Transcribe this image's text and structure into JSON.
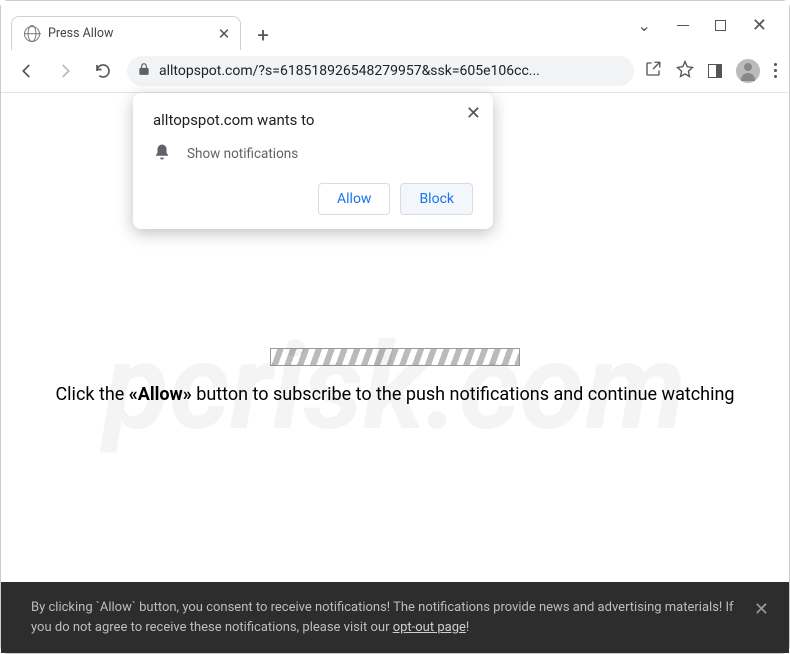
{
  "window": {
    "tab_title": "Press Allow"
  },
  "toolbar": {
    "url": "alltopspot.com/?s=618518926548279957&ssk=605e106cc..."
  },
  "permission": {
    "wants_to": "alltopspot.com wants to",
    "show_notifications": "Show notifications",
    "allow": "Allow",
    "block": "Block"
  },
  "page": {
    "msg_prefix": "Click the ",
    "msg_bold": "«Allow»",
    "msg_suffix": " button to subscribe to the push notifications and continue watching"
  },
  "banner": {
    "text_prefix": "By clicking `Allow` button, you consent to receive notifications! The notifications provide news and advertising materials! If you do not agree to receive these notifications, please visit our ",
    "link": "opt-out page",
    "text_suffix": "!"
  },
  "watermark": "pcrisk.com"
}
